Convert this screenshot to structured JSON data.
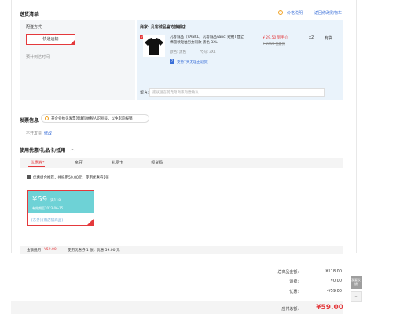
{
  "shipping": {
    "title": "送货清单",
    "price_info_link": "价格说明",
    "return_cart_link": "返回修改购物车",
    "method_label": "配送方式",
    "method_button": "快递运输",
    "estimate_label": "预计到达时间"
  },
  "order": {
    "store_label": "商家: 凡客诚品官方旗舰店",
    "product_name_line1": "凡客诚品（VANCL）凡客诚品vancl 短袖T恤全",
    "product_name_line2": "棉圆领短袖男女同款 黑色 3XL",
    "color_label": "颜色: 黑色",
    "size_label": "尺码: 3XL",
    "return_badge": "支持7天无理由退货",
    "price": "¥ 29.50 到手价",
    "original_price": "¥ 59.00 优惠价",
    "quantity": "x2",
    "stock": "有货",
    "message_label": "留言:",
    "message_placeholder": "建议留言前先与商家沟通确认"
  },
  "invoice": {
    "title": "发票信息",
    "notice": "开企业抬头发票须填写纳税人识别号，以免影响报销",
    "status": "不开发票",
    "edit_link": "修改"
  },
  "coupons": {
    "title": "使用优惠/礼品卡/抵用",
    "tabs": [
      "优惠券",
      "京豆",
      "礼品卡",
      "领货码"
    ],
    "tab_badge": "*",
    "auto_use": "优惠组合推荐，共抵用59.00元；使用优惠券1张",
    "coupon_amount": "¥59",
    "coupon_condition": "满118",
    "coupon_expiry": "有效期至2023-06-15",
    "coupon_tags": "[东券] [限店铺商品]",
    "summary_amount_label": "金额抵用",
    "summary_amount": "¥59.00",
    "summary_detail": "使用优惠券 1 张，优惠 59.00 元"
  },
  "totals": {
    "goods_label": "总商品金额:",
    "goods_value": "¥118.00",
    "freight_label": "运费:",
    "freight_value": "¥0.00",
    "discount_label": "优惠:",
    "discount_value": "-¥59.00",
    "pay_label": "应付总额:",
    "pay_value": "¥59.00"
  },
  "side": {
    "feedback_label": "我要反馈",
    "up_icon": "chevron-up-icon"
  },
  "colors": {
    "accent": "#e4393c",
    "link": "#3a6fd8",
    "coupon": "#6ed2d6"
  }
}
